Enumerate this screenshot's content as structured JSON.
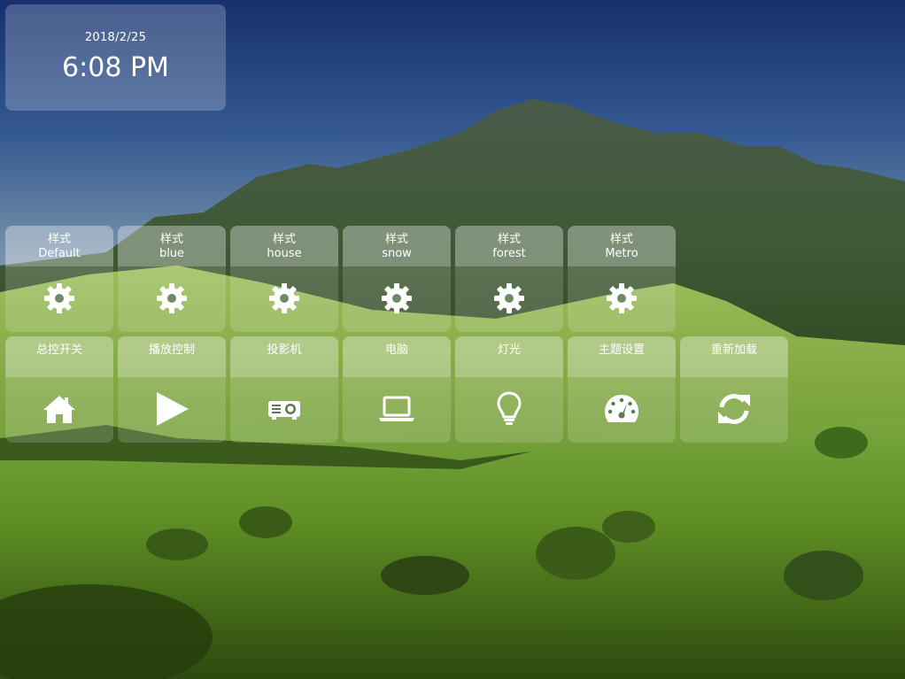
{
  "clock": {
    "date": "2018/2/25",
    "time": "6:08 PM"
  },
  "style_tiles": [
    {
      "line1": "样式",
      "line2": "Default",
      "icon": "gear-icon"
    },
    {
      "line1": "样式",
      "line2": "blue",
      "icon": "gear-icon"
    },
    {
      "line1": "样式",
      "line2": "house",
      "icon": "gear-icon"
    },
    {
      "line1": "样式",
      "line2": "snow",
      "icon": "gear-icon"
    },
    {
      "line1": "样式",
      "line2": "forest",
      "icon": "gear-icon"
    },
    {
      "line1": "样式",
      "line2": "Metro",
      "icon": "gear-icon"
    }
  ],
  "control_tiles": [
    {
      "label": "总控开关",
      "icon": "home-icon"
    },
    {
      "label": "播放控制",
      "icon": "play-icon"
    },
    {
      "label": "投影机",
      "icon": "projector-icon"
    },
    {
      "label": "电脑",
      "icon": "laptop-icon"
    },
    {
      "label": "灯光",
      "icon": "lightbulb-icon"
    },
    {
      "label": "主题设置",
      "icon": "dashboard-icon"
    },
    {
      "label": "重新加载",
      "icon": "refresh-icon"
    }
  ],
  "colors": {
    "tile_text": "#ffffff",
    "icon": "#ffffff"
  }
}
